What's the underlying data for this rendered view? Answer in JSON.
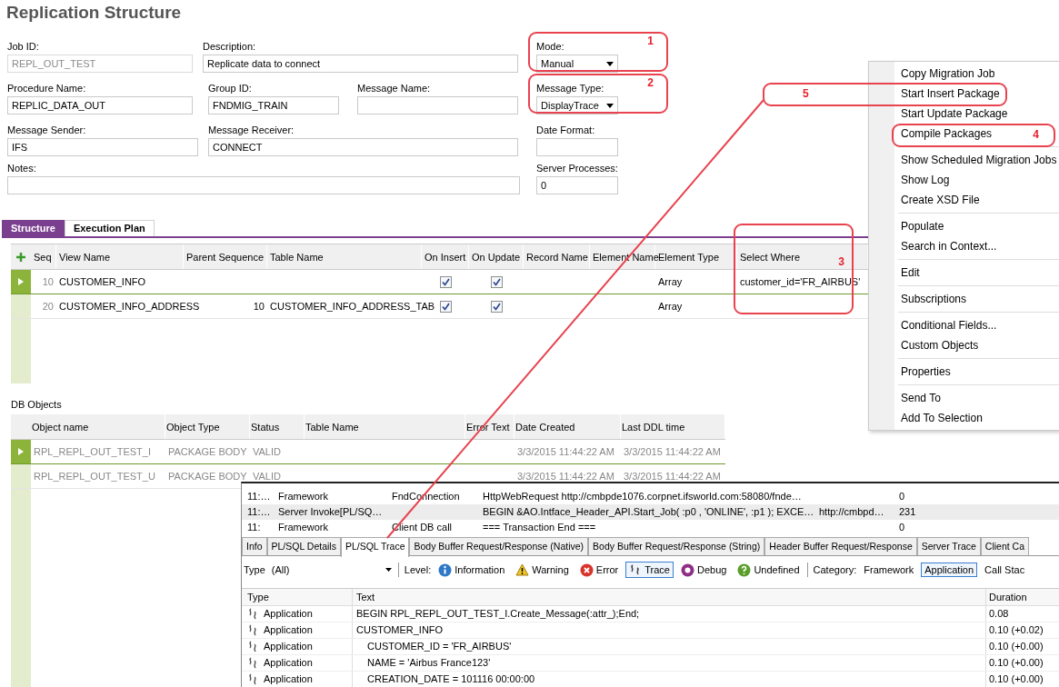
{
  "title": "Replication Structure",
  "form_rows": [
    [
      {
        "label": "Job ID:",
        "value": "REPL_OUT_TEST",
        "kind": "text",
        "disabled": true
      },
      {
        "label": "Description:",
        "value": "Replicate data to connect",
        "kind": "text",
        "disabled": false
      },
      {
        "label": "Mode:",
        "value": "Manual",
        "kind": "dropdown",
        "disabled": false,
        "annotation": "1"
      }
    ],
    [
      {
        "label": "Procedure Name:",
        "value": "REPLIC_DATA_OUT",
        "kind": "text",
        "disabled": false
      },
      {
        "label": "Group ID:",
        "value": "FNDMIG_TRAIN",
        "kind": "text",
        "disabled": false
      },
      {
        "label": "Message Name:",
        "kind": "text",
        "disabled": false
      },
      {
        "label": "Message Type:",
        "value": "DisplayTrace",
        "kind": "dropdown",
        "disabled": false,
        "annotation": "2"
      }
    ],
    [
      {
        "label": "Message Sender:",
        "value": "IFS",
        "kind": "text",
        "disabled": false
      },
      {
        "label": "Message Receiver:",
        "value": "CONNECT",
        "kind": "text",
        "disabled": false
      },
      {
        "label": "Date Format:",
        "kind": "text",
        "disabled": false
      }
    ],
    [
      {
        "label": "Notes:",
        "kind": "text",
        "disabled": false
      },
      {
        "label": "Server Processes:",
        "value": "0",
        "kind": "text",
        "disabled": false
      }
    ]
  ],
  "structure_tabs": [
    {
      "label": "Structure",
      "selected": true
    },
    {
      "label": "Execution Plan",
      "selected": false
    }
  ],
  "structure_table": {
    "columns": [
      {
        "label": "Seq"
      },
      {
        "label": "View Name"
      },
      {
        "label": "Parent Sequence"
      },
      {
        "label": "Table Name"
      },
      {
        "label": "On Insert"
      },
      {
        "label": "On Update"
      },
      {
        "label": "Record Name"
      },
      {
        "label": "Element Name"
      },
      {
        "label": "Element Type"
      },
      {
        "label": "Select Where",
        "annotation": "3"
      }
    ],
    "rows": [
      {
        "selected": true,
        "seq": "10",
        "view_name": "CUSTOMER_INFO",
        "on_insert": true,
        "on_update": true,
        "element_type": "Array",
        "select_where": "customer_id='FR_AIRBUS'"
      },
      {
        "selected": false,
        "seq": "20",
        "view_name": "CUSTOMER_INFO_ADDRESS",
        "parent_sequence": "10",
        "table_name": "CUSTOMER_INFO_ADDRESS_TAB",
        "on_insert": true,
        "on_update": true,
        "element_type": "Array"
      }
    ]
  },
  "db_objects": {
    "label": "DB Objects",
    "columns": [
      "Object name",
      "Object Type",
      "Status",
      "Table Name",
      "Error Text",
      "Date Created",
      "Last DDL time"
    ],
    "rows": [
      {
        "selected": true,
        "object_name": "RPL_REPL_OUT_TEST_I",
        "object_type": "PACKAGE BODY",
        "status": "VALID",
        "date_created": "3/3/2015 11:44:22 AM",
        "last_ddl_time": "3/3/2015 11:44:22 AM"
      },
      {
        "selected": false,
        "object_name": "RPL_REPL_OUT_TEST_U",
        "object_type": "PACKAGE BODY",
        "status": "VALID",
        "date_created": "3/3/2015 11:44:22 AM",
        "last_ddl_time": "3/3/2015 11:44:22 AM"
      }
    ]
  },
  "context_menu": [
    [
      {
        "label": "Copy Migration Job"
      },
      {
        "label": "Start Insert Package",
        "annotation": "5"
      },
      {
        "label": "Start Update Package"
      },
      {
        "label": "Compile Packages",
        "annotation": "4"
      }
    ],
    [
      {
        "label": "Show Scheduled Migration Jobs"
      },
      {
        "label": "Show Log"
      },
      {
        "label": "Create XSD File"
      }
    ],
    [
      {
        "label": "Populate"
      },
      {
        "label": "Search in Context..."
      }
    ],
    [
      {
        "label": "Edit"
      }
    ],
    [
      {
        "label": "Subscriptions"
      }
    ],
    [
      {
        "label": "Conditional Fields..."
      },
      {
        "label": "Custom Objects"
      }
    ],
    [
      {
        "label": "Properties"
      }
    ],
    [
      {
        "label": "Send To"
      },
      {
        "label": "Add To Selection"
      }
    ]
  ],
  "trace_window": {
    "list_rows": [
      {
        "selected": false,
        "time": "11:…",
        "category": "Framework",
        "component": "FndConnection",
        "text": "HttpWebRequest http://cmbpde1076.corpnet.ifsworld.com:58080/fnde…",
        "duration": "0"
      },
      {
        "selected": true,
        "time": "11:…",
        "category": "Server Invoke[PL/SQ…",
        "text": "BEGIN &AO.Intface_Header_API.Start_Job( :p0 , 'ONLINE', :p1 ); EXCE…",
        "url": "http://cmbpd…",
        "duration": "231"
      },
      {
        "selected": false,
        "time": "11:",
        "category": "Framework",
        "component": "Client DB call",
        "text": "=== Transaction End ===",
        "duration": "0"
      }
    ],
    "tabs": [
      {
        "label": "Info",
        "selected": false
      },
      {
        "label": "PL/SQL Details",
        "selected": false
      },
      {
        "label": "PL/SQL Trace",
        "selected": true
      },
      {
        "label": "Body Buffer Request/Response (Native)",
        "selected": false
      },
      {
        "label": "Body Buffer Request/Response (String)",
        "selected": false
      },
      {
        "label": "Header Buffer Request/Response",
        "selected": false
      },
      {
        "label": "Server Trace",
        "selected": false
      },
      {
        "label": "Client Ca",
        "selected": false
      }
    ],
    "type_label": "Type",
    "type_value": "(All)",
    "level_label": "Level:",
    "levels": [
      {
        "label": "Information",
        "kind": "info",
        "selected": false
      },
      {
        "label": "Warning",
        "kind": "warning",
        "selected": false
      },
      {
        "label": "Error",
        "kind": "error",
        "selected": false
      },
      {
        "label": "Trace",
        "kind": "trace",
        "selected": true
      },
      {
        "label": "Debug",
        "kind": "debug",
        "selected": false
      },
      {
        "label": "Undefined",
        "kind": "undefined",
        "selected": false
      }
    ],
    "category_label": "Category:",
    "categories": [
      {
        "label": "Framework",
        "selected": false
      },
      {
        "label": "Application",
        "selected": true
      },
      {
        "label": "Call Stac",
        "selected": false
      }
    ],
    "trace_columns": [
      "Type",
      "Text",
      "Duration"
    ],
    "trace_rows": [
      {
        "type": "Application",
        "text": "BEGIN RPL_REPL_OUT_TEST_I.Create_Message(:attr_);End;",
        "duration": "0.08"
      },
      {
        "type": "Application",
        "text": "CUSTOMER_INFO",
        "duration": "0.10 (+0.02)",
        "children": [
          {
            "type": "Application",
            "text": "CUSTOMER_ID = 'FR_AIRBUS'",
            "duration": "0.10 (+0.00)"
          },
          {
            "type": "Application",
            "text": "NAME = 'Airbus France123'",
            "duration": "0.10 (+0.00)"
          },
          {
            "type": "Application",
            "text": "CREATION_DATE = 101116 00:00:00",
            "duration": "0.10 (+0.00)"
          }
        ]
      }
    ]
  }
}
